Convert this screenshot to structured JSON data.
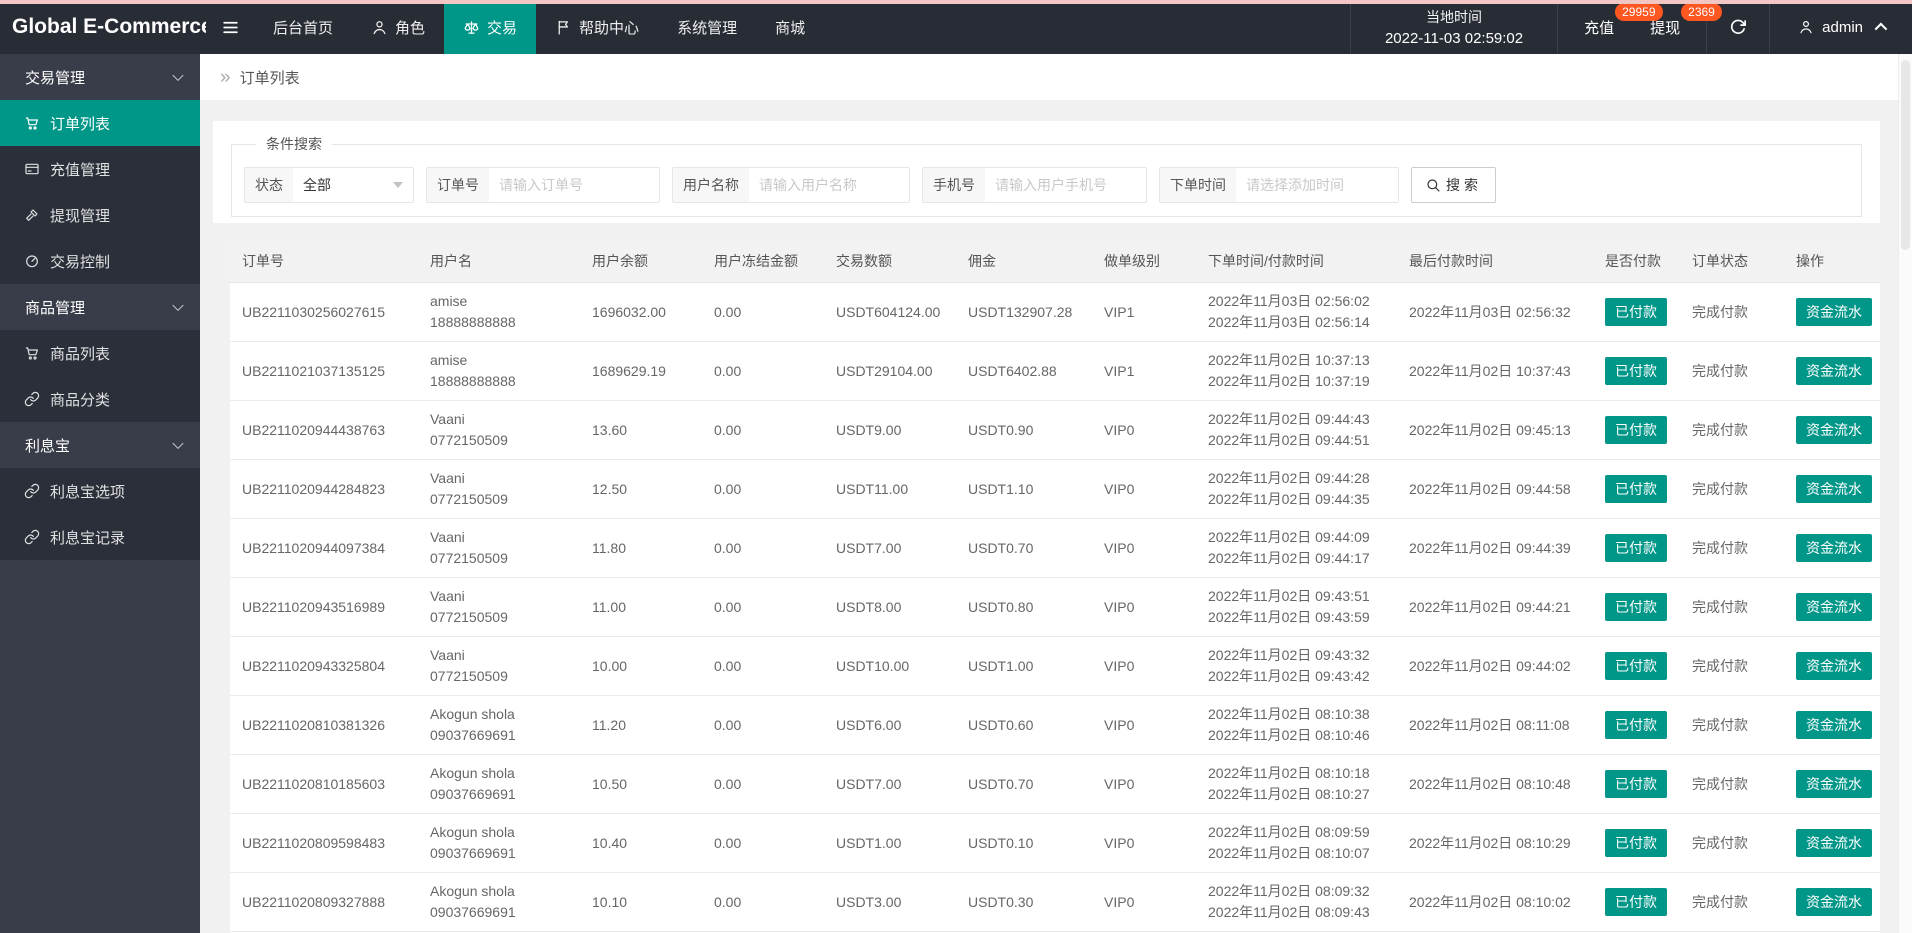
{
  "colors": {
    "accent": "#009688",
    "badge": "#ff5722",
    "header_bg": "#282c35",
    "sidebar_bg": "#393d49"
  },
  "header": {
    "logo": "Global E-Commerce...",
    "nav": [
      {
        "label": "后台首页"
      },
      {
        "label": "角色",
        "icon": "user"
      },
      {
        "label": "交易",
        "icon": "scales",
        "active": true
      },
      {
        "label": "帮助中心",
        "icon": "flag"
      },
      {
        "label": "系统管理"
      },
      {
        "label": "商城"
      }
    ],
    "local_time_label": "当地时间",
    "local_time_value": "2022-11-03 02:59:02",
    "recharge": {
      "label": "充值",
      "badge": "29959"
    },
    "withdraw": {
      "label": "提现",
      "badge": "2369"
    },
    "username": "admin"
  },
  "sidebar": {
    "items": [
      {
        "label": "交易管理",
        "type": "group"
      },
      {
        "label": "订单列表",
        "type": "item",
        "icon": "cart",
        "active": true
      },
      {
        "label": "充值管理",
        "type": "item",
        "icon": "card"
      },
      {
        "label": "提现管理",
        "type": "item",
        "icon": "gavel"
      },
      {
        "label": "交易控制",
        "type": "item",
        "icon": "gauge"
      },
      {
        "label": "商品管理",
        "type": "group"
      },
      {
        "label": "商品列表",
        "type": "item",
        "icon": "cart"
      },
      {
        "label": "商品分类",
        "type": "item",
        "icon": "link"
      },
      {
        "label": "利息宝",
        "type": "group"
      },
      {
        "label": "利息宝选项",
        "type": "item",
        "icon": "link"
      },
      {
        "label": "利息宝记录",
        "type": "item",
        "icon": "link"
      }
    ]
  },
  "breadcrumb": {
    "separator": "»",
    "title": "订单列表"
  },
  "search": {
    "legend": "条件搜索",
    "status_label": "状态",
    "status_value": "全部",
    "order_label": "订单号",
    "order_placeholder": "请输入订单号",
    "user_label": "用户名称",
    "user_placeholder": "请输入用户名称",
    "phone_label": "手机号",
    "phone_placeholder": "请输入用户手机号",
    "time_label": "下单时间",
    "time_placeholder": "请选择添加时间",
    "button_label": "搜索"
  },
  "table": {
    "columns": [
      "订单号",
      "用户名",
      "用户余额",
      "用户冻结金额",
      "交易数额",
      "佣金",
      "做单级别",
      "下单时间/付款时间",
      "最后付款时间",
      "是否付款",
      "订单状态",
      "操作"
    ],
    "rows": [
      {
        "order_no": "UB2211030256027615",
        "user_name": "amise",
        "user_account": "18888888888",
        "balance": "1696032.00",
        "frozen": "0.00",
        "amount": "USDT604124.00",
        "commission": "USDT132907.28",
        "level": "VIP1",
        "order_time": "2022年11月03日 02:56:02",
        "pay_time": "2022年11月03日 02:56:14",
        "last_pay_time": "2022年11月03日 02:56:32",
        "paid_label": "已付款",
        "status": "完成付款",
        "action_label": "资金流水"
      },
      {
        "order_no": "UB2211021037135125",
        "user_name": "amise",
        "user_account": "18888888888",
        "balance": "1689629.19",
        "frozen": "0.00",
        "amount": "USDT29104.00",
        "commission": "USDT6402.88",
        "level": "VIP1",
        "order_time": "2022年11月02日 10:37:13",
        "pay_time": "2022年11月02日 10:37:19",
        "last_pay_time": "2022年11月02日 10:37:43",
        "paid_label": "已付款",
        "status": "完成付款",
        "action_label": "资金流水"
      },
      {
        "order_no": "UB2211020944438763",
        "user_name": "Vaani",
        "user_account": "0772150509",
        "balance": "13.60",
        "frozen": "0.00",
        "amount": "USDT9.00",
        "commission": "USDT0.90",
        "level": "VIP0",
        "order_time": "2022年11月02日 09:44:43",
        "pay_time": "2022年11月02日 09:44:51",
        "last_pay_time": "2022年11月02日 09:45:13",
        "paid_label": "已付款",
        "status": "完成付款",
        "action_label": "资金流水"
      },
      {
        "order_no": "UB2211020944284823",
        "user_name": "Vaani",
        "user_account": "0772150509",
        "balance": "12.50",
        "frozen": "0.00",
        "amount": "USDT11.00",
        "commission": "USDT1.10",
        "level": "VIP0",
        "order_time": "2022年11月02日 09:44:28",
        "pay_time": "2022年11月02日 09:44:35",
        "last_pay_time": "2022年11月02日 09:44:58",
        "paid_label": "已付款",
        "status": "完成付款",
        "action_label": "资金流水"
      },
      {
        "order_no": "UB2211020944097384",
        "user_name": "Vaani",
        "user_account": "0772150509",
        "balance": "11.80",
        "frozen": "0.00",
        "amount": "USDT7.00",
        "commission": "USDT0.70",
        "level": "VIP0",
        "order_time": "2022年11月02日 09:44:09",
        "pay_time": "2022年11月02日 09:44:17",
        "last_pay_time": "2022年11月02日 09:44:39",
        "paid_label": "已付款",
        "status": "完成付款",
        "action_label": "资金流水"
      },
      {
        "order_no": "UB2211020943516989",
        "user_name": "Vaani",
        "user_account": "0772150509",
        "balance": "11.00",
        "frozen": "0.00",
        "amount": "USDT8.00",
        "commission": "USDT0.80",
        "level": "VIP0",
        "order_time": "2022年11月02日 09:43:51",
        "pay_time": "2022年11月02日 09:43:59",
        "last_pay_time": "2022年11月02日 09:44:21",
        "paid_label": "已付款",
        "status": "完成付款",
        "action_label": "资金流水"
      },
      {
        "order_no": "UB2211020943325804",
        "user_name": "Vaani",
        "user_account": "0772150509",
        "balance": "10.00",
        "frozen": "0.00",
        "amount": "USDT10.00",
        "commission": "USDT1.00",
        "level": "VIP0",
        "order_time": "2022年11月02日 09:43:32",
        "pay_time": "2022年11月02日 09:43:42",
        "last_pay_time": "2022年11月02日 09:44:02",
        "paid_label": "已付款",
        "status": "完成付款",
        "action_label": "资金流水"
      },
      {
        "order_no": "UB2211020810381326",
        "user_name": "Akogun shola",
        "user_account": "09037669691",
        "balance": "11.20",
        "frozen": "0.00",
        "amount": "USDT6.00",
        "commission": "USDT0.60",
        "level": "VIP0",
        "order_time": "2022年11月02日 08:10:38",
        "pay_time": "2022年11月02日 08:10:46",
        "last_pay_time": "2022年11月02日 08:11:08",
        "paid_label": "已付款",
        "status": "完成付款",
        "action_label": "资金流水"
      },
      {
        "order_no": "UB2211020810185603",
        "user_name": "Akogun shola",
        "user_account": "09037669691",
        "balance": "10.50",
        "frozen": "0.00",
        "amount": "USDT7.00",
        "commission": "USDT0.70",
        "level": "VIP0",
        "order_time": "2022年11月02日 08:10:18",
        "pay_time": "2022年11月02日 08:10:27",
        "last_pay_time": "2022年11月02日 08:10:48",
        "paid_label": "已付款",
        "status": "完成付款",
        "action_label": "资金流水"
      },
      {
        "order_no": "UB2211020809598483",
        "user_name": "Akogun shola",
        "user_account": "09037669691",
        "balance": "10.40",
        "frozen": "0.00",
        "amount": "USDT1.00",
        "commission": "USDT0.10",
        "level": "VIP0",
        "order_time": "2022年11月02日 08:09:59",
        "pay_time": "2022年11月02日 08:10:07",
        "last_pay_time": "2022年11月02日 08:10:29",
        "paid_label": "已付款",
        "status": "完成付款",
        "action_label": "资金流水"
      },
      {
        "order_no": "UB2211020809327888",
        "user_name": "Akogun shola",
        "user_account": "09037669691",
        "balance": "10.10",
        "frozen": "0.00",
        "amount": "USDT3.00",
        "commission": "USDT0.30",
        "level": "VIP0",
        "order_time": "2022年11月02日 08:09:32",
        "pay_time": "2022年11月02日 08:09:43",
        "last_pay_time": "2022年11月02日 08:10:02",
        "paid_label": "已付款",
        "status": "完成付款",
        "action_label": "资金流水"
      }
    ]
  }
}
